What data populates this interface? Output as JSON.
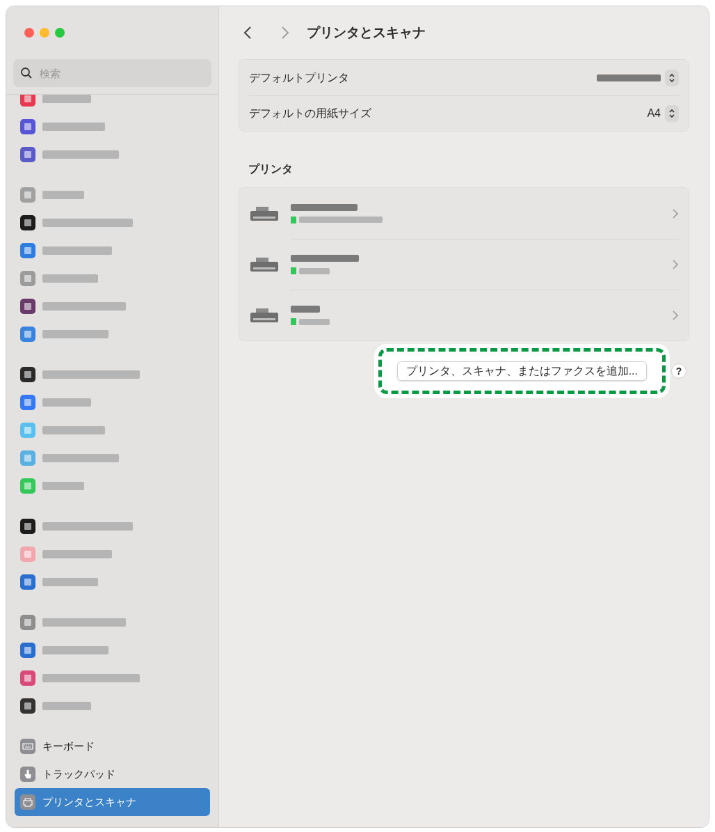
{
  "search": {
    "placeholder": "検索"
  },
  "sidebar": {
    "groups": [
      {
        "items": [
          {
            "kind": "redacted",
            "color": "#e8384f",
            "selected": false
          },
          {
            "kind": "redacted",
            "color": "#5856d6",
            "selected": false
          },
          {
            "kind": "redacted",
            "color": "#5b5bc8",
            "selected": false
          }
        ]
      },
      {
        "items": [
          {
            "kind": "redacted",
            "color": "#a0a0a0",
            "selected": false
          },
          {
            "kind": "redacted",
            "color": "#1c1c1c",
            "selected": false
          },
          {
            "kind": "redacted",
            "color": "#2f7de1",
            "selected": false
          },
          {
            "kind": "redacted",
            "color": "#9c9c9c",
            "selected": false
          },
          {
            "kind": "redacted",
            "color": "#6a3a6a",
            "selected": false
          },
          {
            "kind": "redacted",
            "color": "#3a84e0",
            "selected": false
          }
        ]
      },
      {
        "items": [
          {
            "kind": "redacted",
            "color": "#2a2a2a",
            "selected": false
          },
          {
            "kind": "redacted",
            "color": "#3478f6",
            "selected": false
          },
          {
            "kind": "redacted",
            "color": "#5ac0f0",
            "selected": false
          },
          {
            "kind": "redacted",
            "color": "#5ab0e0",
            "selected": false
          },
          {
            "kind": "redacted",
            "color": "#34c759",
            "selected": false
          }
        ]
      },
      {
        "items": [
          {
            "kind": "redacted",
            "color": "#1c1c1c",
            "selected": false
          },
          {
            "kind": "redacted",
            "color": "#f2a6ae",
            "selected": false
          },
          {
            "kind": "redacted",
            "color": "#2a6fd0",
            "selected": false
          }
        ]
      },
      {
        "items": [
          {
            "kind": "redacted",
            "color": "#8e8e8e",
            "selected": false
          },
          {
            "kind": "redacted",
            "color": "#2a6fd0",
            "selected": false
          },
          {
            "kind": "redacted",
            "color": "#d84a7a",
            "selected": false
          },
          {
            "kind": "redacted",
            "color": "#333333",
            "selected": false
          }
        ]
      },
      {
        "items": [
          {
            "kind": "keyboard",
            "label": "キーボード",
            "color": "#8e8e93",
            "selected": false
          },
          {
            "kind": "trackpad",
            "label": "トラックパッド",
            "color": "#8e8e93",
            "selected": false
          },
          {
            "kind": "printer",
            "label": "プリンタとスキャナ",
            "color": "#8e8e93",
            "selected": true
          }
        ]
      }
    ]
  },
  "header": {
    "title": "プリンタとスキャナ"
  },
  "defaults": [
    {
      "label": "デフォルトプリンタ"
    },
    {
      "label": "デフォルトの用紙サイズ",
      "value": "A4"
    }
  ],
  "printers_section": {
    "title": "プリンタ"
  },
  "printers": [
    {
      "color": "#34c759"
    },
    {
      "color": "#34c759"
    },
    {
      "color": "#34c759"
    }
  ],
  "add_button": {
    "label": "プリンタ、スキャナ、またはファクスを追加...",
    "highlighted": true
  },
  "help_button": {
    "label": "?"
  }
}
